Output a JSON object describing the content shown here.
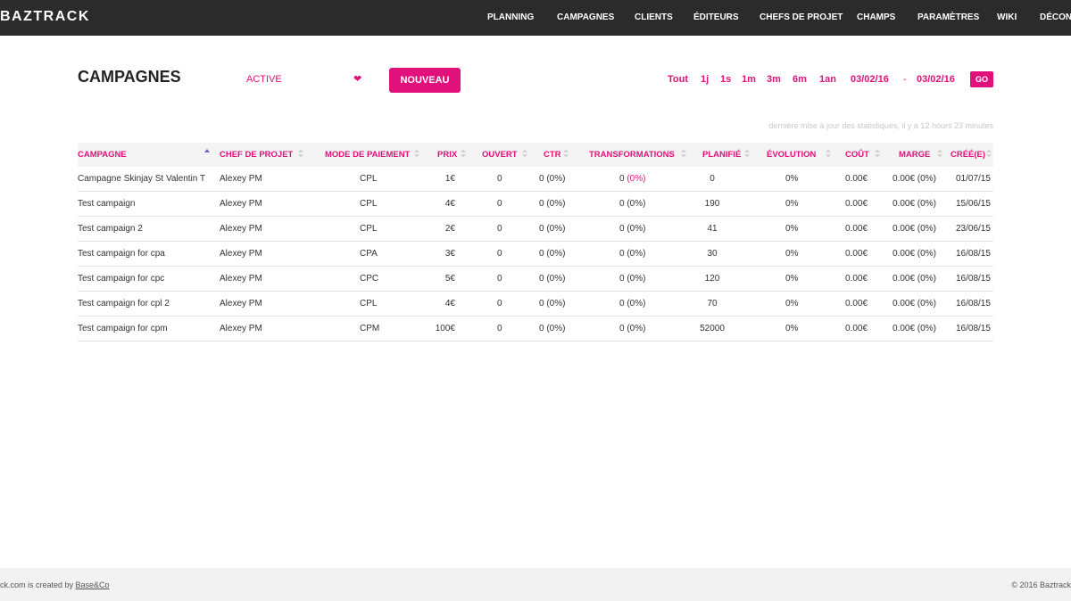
{
  "header": {
    "logo": "BAZTRACK",
    "nav": [
      "PLANNING",
      "CAMPAGNES",
      "CLIENTS",
      "ÉDITEURS",
      "CHEFS DE PROJET",
      "CHAMPS",
      "PARAMÈTRES",
      "WIKI",
      "DÉCON"
    ]
  },
  "toolbar": {
    "title": "CAMPAGNES",
    "status_value": "ACTIVE",
    "new_label": "NOUVEAU",
    "ranges": [
      "Tout",
      "1j",
      "1s",
      "1m",
      "3m",
      "6m",
      "1an"
    ],
    "date_from": "03/02/16",
    "date_sep": "-",
    "date_to": "03/02/16",
    "go_label": "GO"
  },
  "last_update": "dernière mise à jour des statistiques, il y a 12 hours 23 minutes",
  "table": {
    "columns": [
      "CAMPAGNE",
      "CHEF DE PROJET",
      "MODE DE PAIEMENT",
      "PRIX",
      "OUVERT",
      "CTR",
      "TRANSFORMATIONS",
      "PLANIFIÉ",
      "ÉVOLUTION",
      "COÛT",
      "MARGE",
      "CRÉÉ(E)"
    ],
    "rows": [
      {
        "campagne": "Campagne Skinjay St Valentin T",
        "chef": "Alexey PM",
        "mode": "CPL",
        "prix": "1€",
        "ouvert": "0",
        "ctr": "0 (0%)",
        "trans": "0",
        "trans_pct": "(0%)",
        "planifie": "0",
        "evolution": "0%",
        "cout": "0.00€",
        "marge": "0.00€ (0%)",
        "cree": "01/07/15"
      },
      {
        "campagne": "Test campaign",
        "chef": "Alexey PM",
        "mode": "CPL",
        "prix": "4€",
        "ouvert": "0",
        "ctr": "0 (0%)",
        "trans": "0",
        "trans_pct": "(0%)",
        "planifie": "190",
        "evolution": "0%",
        "cout": "0.00€",
        "marge": "0.00€ (0%)",
        "cree": "15/06/15"
      },
      {
        "campagne": "Test campaign 2",
        "chef": "Alexey PM",
        "mode": "CPL",
        "prix": "2€",
        "ouvert": "0",
        "ctr": "0 (0%)",
        "trans": "0",
        "trans_pct": "(0%)",
        "planifie": "41",
        "evolution": "0%",
        "cout": "0.00€",
        "marge": "0.00€ (0%)",
        "cree": "23/06/15"
      },
      {
        "campagne": "Test campaign for cpa",
        "chef": "Alexey PM",
        "mode": "CPA",
        "prix": "3€",
        "ouvert": "0",
        "ctr": "0 (0%)",
        "trans": "0",
        "trans_pct": "(0%)",
        "planifie": "30",
        "evolution": "0%",
        "cout": "0.00€",
        "marge": "0.00€ (0%)",
        "cree": "16/08/15"
      },
      {
        "campagne": "Test campaign for cpc",
        "chef": "Alexey PM",
        "mode": "CPC",
        "prix": "5€",
        "ouvert": "0",
        "ctr": "0 (0%)",
        "trans": "0",
        "trans_pct": "(0%)",
        "planifie": "120",
        "evolution": "0%",
        "cout": "0.00€",
        "marge": "0.00€ (0%)",
        "cree": "16/08/15"
      },
      {
        "campagne": "Test campaign for cpl 2",
        "chef": "Alexey PM",
        "mode": "CPL",
        "prix": "4€",
        "ouvert": "0",
        "ctr": "0 (0%)",
        "trans": "0",
        "trans_pct": "(0%)",
        "planifie": "70",
        "evolution": "0%",
        "cout": "0.00€",
        "marge": "0.00€ (0%)",
        "cree": "16/08/15"
      },
      {
        "campagne": "Test campaign for cpm",
        "chef": "Alexey PM",
        "mode": "CPM",
        "prix": "100€",
        "ouvert": "0",
        "ctr": "0 (0%)",
        "trans": "0",
        "trans_pct": "(0%)",
        "planifie": "52000",
        "evolution": "0%",
        "cout": "0.00€",
        "marge": "0.00€ (0%)",
        "cree": "16/08/15"
      }
    ]
  },
  "footer": {
    "left_text": "ck.com is created by ",
    "left_link": "Base&Co",
    "right_text": "© 2016 Baztrack"
  },
  "colors": {
    "accent": "#e0117a",
    "topbar": "#2b2b2b"
  }
}
